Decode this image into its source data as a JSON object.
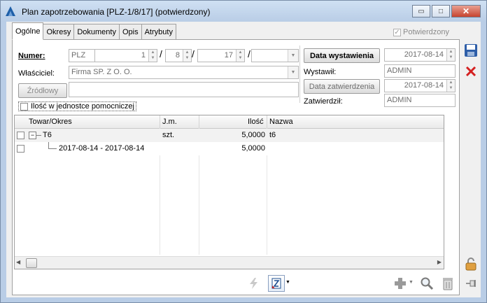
{
  "window": {
    "title": "Plan zapotrzebowania [PLZ-1/8/17]  (potwierdzony)",
    "minimize_glyph": "▭",
    "maximize_glyph": "□",
    "close_glyph": "✕"
  },
  "tabs": [
    "Ogólne",
    "Okresy",
    "Dokumenty",
    "Opis",
    "Atrybuty"
  ],
  "confirmed": {
    "label": "Potwierdzony",
    "checked": true
  },
  "numer": {
    "label": "Numer:",
    "prefix": "PLZ",
    "num": "1",
    "sep1": "/",
    "month": "8",
    "sep2": "/",
    "year": "17",
    "sep3": "/",
    "series": ""
  },
  "owner": {
    "label": "Właściciel:",
    "value": "Firma SP. Z O. O."
  },
  "source": {
    "button": "Źródłowy",
    "value": ""
  },
  "aux_unit": {
    "label": "Ilość w jednostce pomocniczej",
    "checked": false
  },
  "right_panel": {
    "issue_date_button": "Data wystawienia",
    "issue_date": "2017-08-14",
    "issued_by_label": "Wystawił:",
    "issued_by": "ADMIN",
    "approve_date_button": "Data zatwierdzenia",
    "approve_date": "2017-08-14",
    "approved_by_label": "Zatwierdził:",
    "approved_by": "ADMIN"
  },
  "grid": {
    "columns": [
      "Towar/Okres",
      "J.m.",
      "Ilość",
      "Nazwa"
    ],
    "rows": [
      {
        "expander": "−",
        "item": "T6",
        "unit": "szt.",
        "qty": "5,0000",
        "name": "t6"
      },
      {
        "expander": "",
        "item": "2017-08-14 - 2017-08-14",
        "unit": "",
        "qty": "5,0000",
        "name": ""
      }
    ]
  },
  "colors": {
    "accent": "#2060b0",
    "delete": "#d42020"
  }
}
